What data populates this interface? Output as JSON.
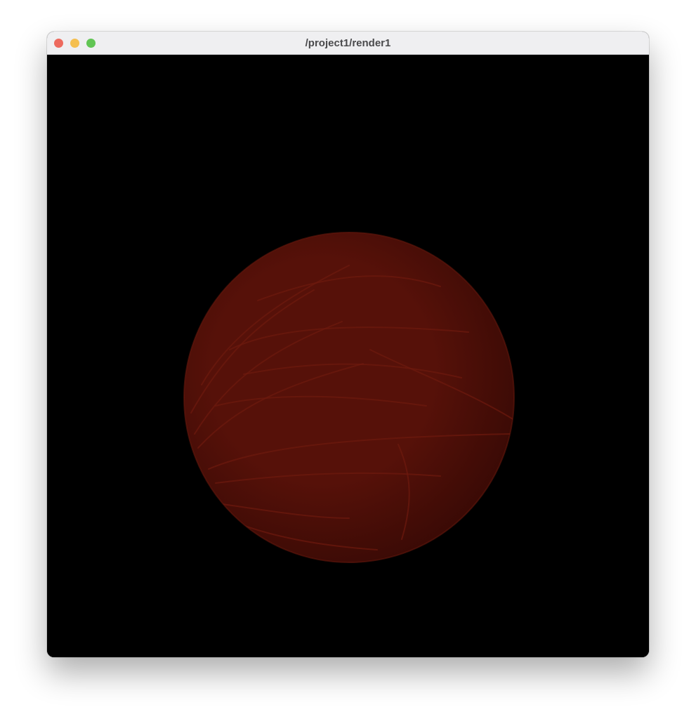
{
  "window": {
    "title": "/project1/render1",
    "buttons": {
      "close_color": "#ed6a5e",
      "minimize_color": "#f5bf4f",
      "zoom_color": "#61c554"
    }
  },
  "render": {
    "background_color": "#000000",
    "sphere_color": "#561109",
    "sphere_highlight_color": "#6e1a0e",
    "sphere_shadow_color": "#3a0a05"
  }
}
